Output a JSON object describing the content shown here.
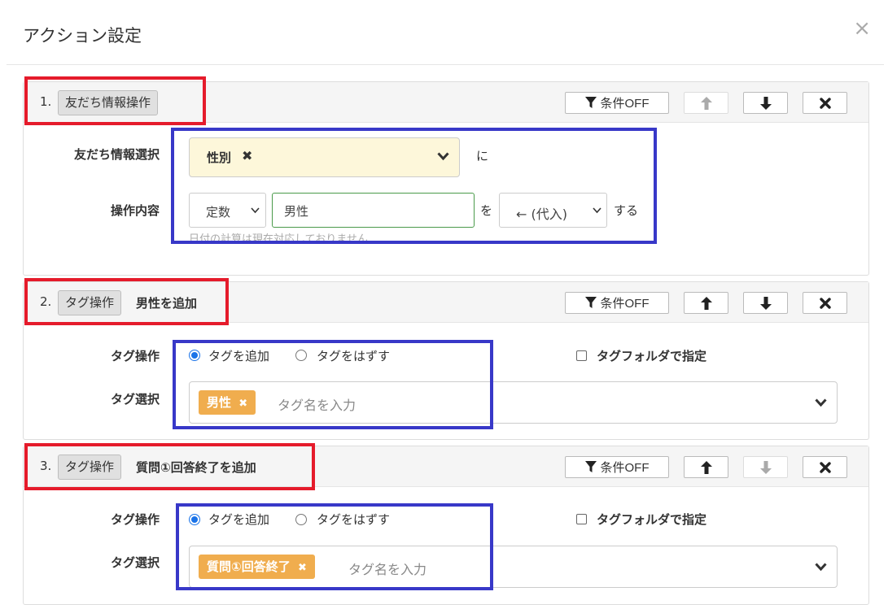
{
  "dialog": {
    "title": "アクション設定",
    "close": "×"
  },
  "actions": [
    {
      "num": "1.",
      "type": "友だち情報操作",
      "buttons": {
        "condition": "条件OFF"
      },
      "friend_select_label": "友だち情報選択",
      "friend_field": "性別",
      "chip_remove": "✖",
      "suffix_ni": "に",
      "operation_label": "操作内容",
      "operand_type": "定数",
      "value": "男性",
      "particle_wo": "を",
      "operator": "← (代入)",
      "suffix_suru": "する",
      "hint": "日付の計算は現在対応しておりません"
    },
    {
      "num": "2.",
      "type": "タグ操作",
      "title": "男性を追加",
      "buttons": {
        "condition": "条件OFF"
      },
      "tag_op_label": "タグ操作",
      "radio_add": "タグを追加",
      "radio_remove": "タグをはずす",
      "folder_check": "タグフォルダで指定",
      "tag_select_label": "タグ選択",
      "tag": "男性",
      "tag_remove": "✖",
      "tag_placeholder": "タグ名を入力"
    },
    {
      "num": "3.",
      "type": "タグ操作",
      "title": "質問①回答終了を追加",
      "buttons": {
        "condition": "条件OFF"
      },
      "tag_op_label": "タグ操作",
      "radio_add": "タグを追加",
      "radio_remove": "タグをはずす",
      "folder_check": "タグフォルダで指定",
      "tag_select_label": "タグ選択",
      "tag": "質問①回答終了",
      "tag_remove": "✖",
      "tag_placeholder": "タグ名を入力"
    }
  ],
  "icons": [
    "filter-icon",
    "arrow-up-icon",
    "arrow-down-icon",
    "times-icon",
    "chevron-down-icon"
  ],
  "colors": {
    "highlight_red": "#e51b2b",
    "highlight_blue": "#3838c8",
    "tag_orange": "#f0ad4e",
    "select_yellow": "#fdf7da",
    "radio_blue": "#1a73e8"
  }
}
